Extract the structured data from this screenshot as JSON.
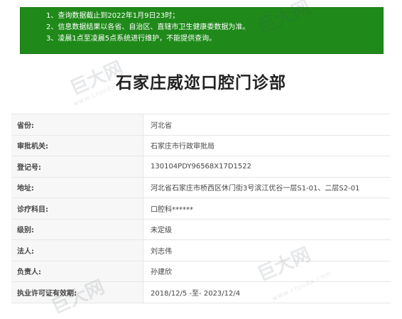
{
  "notice": {
    "lines": [
      "1、查询数据截止到2022年1月9日23时；",
      "2、信息数据结果以各省、自治区、直辖市卫生健康委数据为准。",
      "3、凌晨1点至凌晨5点系统进行维护，不能提供查询。"
    ]
  },
  "page_title": "石家庄威迩口腔门诊部",
  "rows": [
    {
      "label": "省份:",
      "value": "河北省"
    },
    {
      "label": "审批机关:",
      "value": "石家庄市行政审批局"
    },
    {
      "label": "登记号:",
      "value": "130104PDY96568X17D1522"
    },
    {
      "label": "地址:",
      "value": "河北省石家庄市桥西区休门街3号滨江优谷一层S1-01、二层S2-01"
    },
    {
      "label": "诊疗科目:",
      "value": "口腔科******"
    },
    {
      "label": "级别:",
      "value": "未定级"
    },
    {
      "label": "法人:",
      "value": "刘志伟"
    },
    {
      "label": "负责人:",
      "value": "孙建欣"
    },
    {
      "label": "执业许可证有效期:",
      "value": "2018/12/5 -至- 2023/12/4"
    }
  ],
  "watermark": {
    "brand": "巨大网",
    "url": "www.cnjuda.com"
  }
}
